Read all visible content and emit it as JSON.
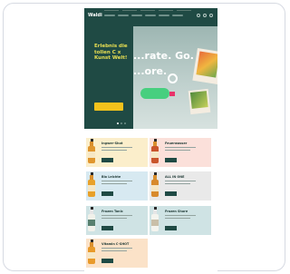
{
  "brand": {
    "logo": "Waldi",
    "colors": {
      "nav": "#1f4a44",
      "headline": "#e9df52",
      "cta": "#f2c21c",
      "pill": "#47cf7f",
      "accent": "#e8336a"
    }
  },
  "nav": {
    "icons": [
      "search-icon",
      "user-icon",
      "cart-icon"
    ]
  },
  "hero": {
    "headline": "Erlebnis die tollen C x Kunst Welt!",
    "body": "",
    "cta_label": "",
    "big_line_1": "...rate. Go.",
    "big_line_2": "...ore.",
    "pill_label": "",
    "slides": 3,
    "active_slide": 1
  },
  "products": [
    {
      "title": "Ingwer-Shot",
      "button": "",
      "bg": "#fbeecb"
    },
    {
      "title": "Feuerwasser",
      "button": "",
      "bg": "#fbe0da"
    },
    {
      "title": "Bio Leichte",
      "button": "",
      "bg": "#d7e9f1"
    },
    {
      "title": "ALL IN ONE",
      "button": "",
      "bg": "#e9e9e9"
    },
    {
      "title": "Frozen Tonic",
      "button": "",
      "bg": "#cfe3e4"
    },
    {
      "title": "Frozen Shore",
      "button": "",
      "bg": "#cfe3e4"
    },
    {
      "title": "Vitamin C-SHOT",
      "button": "",
      "bg": "#fbe2c8"
    }
  ],
  "footer": {
    "text": ""
  }
}
